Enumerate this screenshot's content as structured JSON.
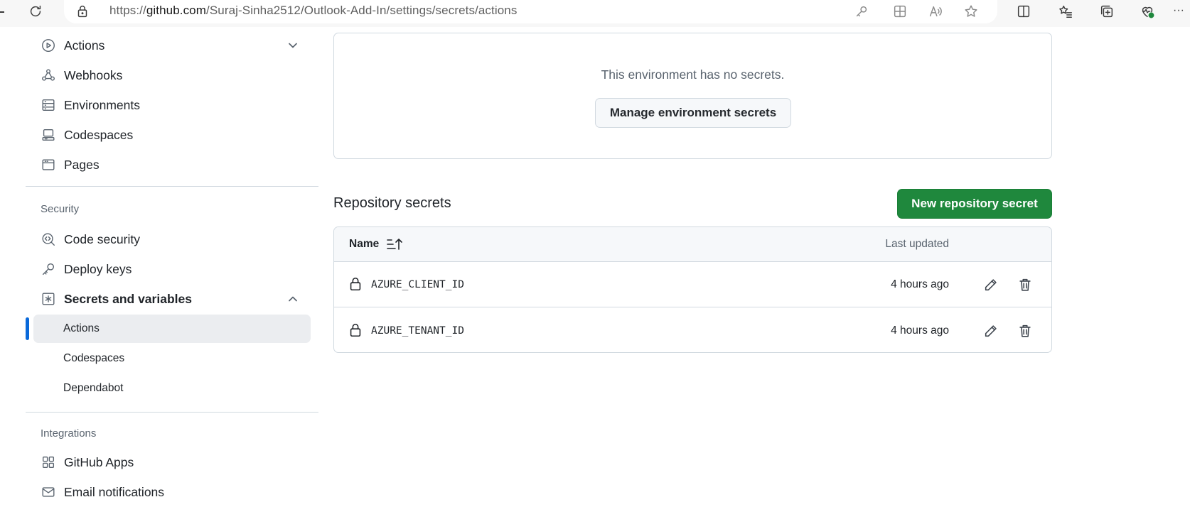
{
  "browser": {
    "url_prefix": "https://",
    "url_host": "github.com",
    "url_path": "/Suraj-Sinha2512/Outlook-Add-In/settings/secrets/actions",
    "icons": [
      "refresh-icon",
      "lock-icon",
      "key-icon",
      "app-icon",
      "read-aloud-icon",
      "favorite-star-icon",
      "split-screen-icon",
      "favorites-icon",
      "collections-icon",
      "browser-health-icon",
      "more-icon"
    ],
    "more_label": "···"
  },
  "sidebar": {
    "top_items": [
      {
        "label": "Actions",
        "icon": "play-circle-icon"
      },
      {
        "label": "Webhooks",
        "icon": "webhook-icon"
      },
      {
        "label": "Environments",
        "icon": "server-icon"
      },
      {
        "label": "Codespaces",
        "icon": "codespaces-icon"
      },
      {
        "label": "Pages",
        "icon": "browser-icon"
      }
    ],
    "security_title": "Security",
    "security_items": [
      {
        "label": "Code security",
        "icon": "codescan-icon"
      },
      {
        "label": "Deploy keys",
        "icon": "key-icon"
      },
      {
        "label": "Secrets and variables",
        "icon": "asterisk-square-icon"
      }
    ],
    "secrets_subitems": [
      {
        "label": "Actions",
        "active": true
      },
      {
        "label": "Codespaces",
        "active": false
      },
      {
        "label": "Dependabot",
        "active": false
      }
    ],
    "integrations_title": "Integrations",
    "integrations_items": [
      {
        "label": "GitHub Apps",
        "icon": "apps-icon"
      },
      {
        "label": "Email notifications",
        "icon": "mail-icon"
      }
    ]
  },
  "environment": {
    "message": "This environment has no secrets.",
    "manage_button": "Manage environment secrets"
  },
  "repository_secrets": {
    "title": "Repository secrets",
    "new_button": "New repository secret",
    "columns": {
      "name": "Name",
      "updated": "Last updated"
    },
    "rows": [
      {
        "name": "AZURE_CLIENT_ID",
        "updated": "4 hours ago"
      },
      {
        "name": "AZURE_TENANT_ID",
        "updated": "4 hours ago"
      }
    ]
  },
  "colors": {
    "primary_button": "#1f883d",
    "active_indicator": "#0969da",
    "border": "#d1d9e0",
    "muted_text": "#59636e"
  }
}
